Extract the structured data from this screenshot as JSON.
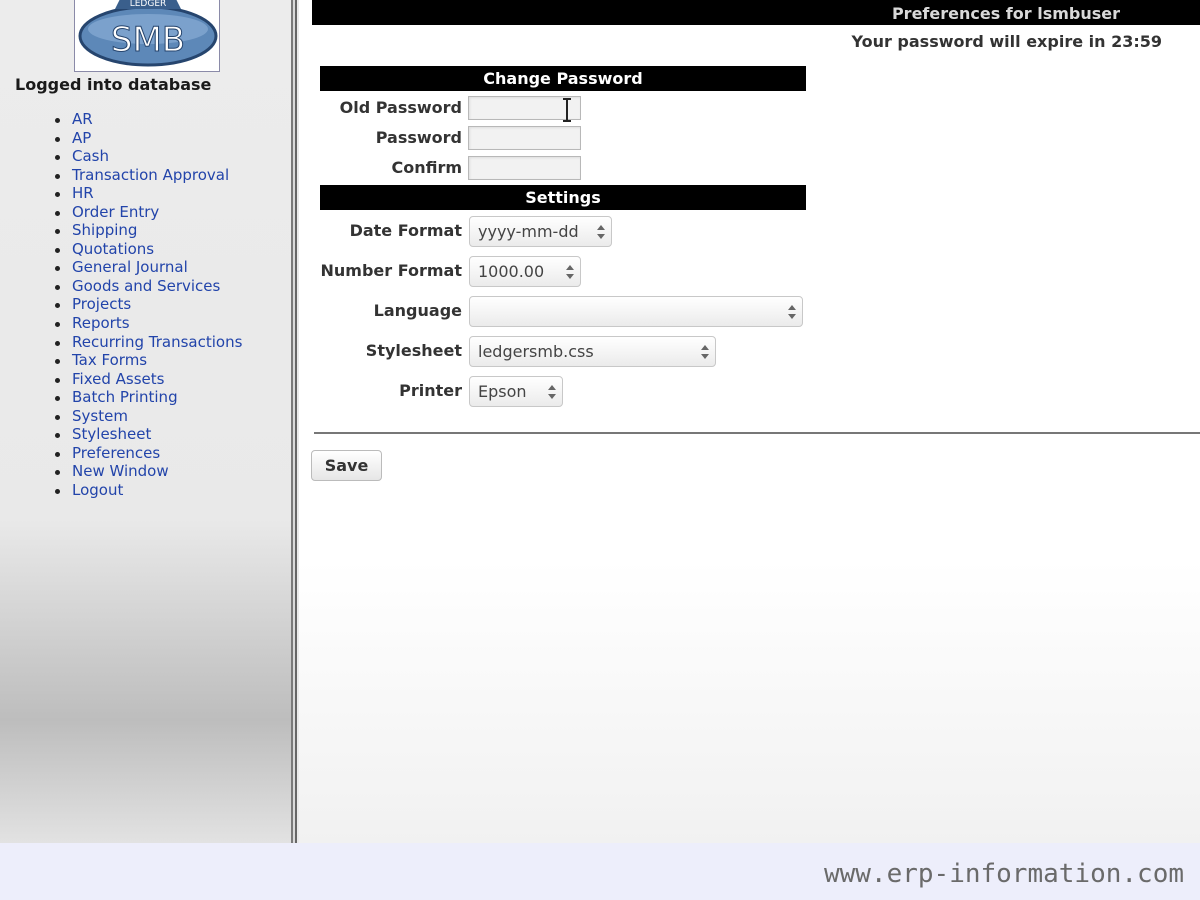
{
  "logo": {
    "top_text": "LEDGER",
    "main_text": "SMB"
  },
  "sidebar": {
    "login_text": "Logged into database",
    "menu": [
      {
        "label": "AR"
      },
      {
        "label": "AP"
      },
      {
        "label": "Cash"
      },
      {
        "label": "Transaction Approval"
      },
      {
        "label": "HR"
      },
      {
        "label": "Order Entry"
      },
      {
        "label": "Shipping"
      },
      {
        "label": "Quotations"
      },
      {
        "label": "General Journal"
      },
      {
        "label": "Goods and Services"
      },
      {
        "label": "Projects"
      },
      {
        "label": "Reports"
      },
      {
        "label": "Recurring Transactions"
      },
      {
        "label": "Tax Forms"
      },
      {
        "label": "Fixed Assets"
      },
      {
        "label": "Batch Printing"
      },
      {
        "label": "System"
      },
      {
        "label": "Stylesheet"
      },
      {
        "label": "Preferences"
      },
      {
        "label": "New Window"
      },
      {
        "label": "Logout"
      }
    ]
  },
  "header": {
    "title": "Preferences for lsmbuser",
    "expire_notice": "Your password will expire in 23:59"
  },
  "change_password": {
    "section_title": "Change Password",
    "old_password_label": "Old Password",
    "old_password_value": "",
    "password_label": "Password",
    "password_value": "",
    "confirm_label": "Confirm",
    "confirm_value": ""
  },
  "settings": {
    "section_title": "Settings",
    "date_format_label": "Date Format",
    "date_format_value": "yyyy-mm-dd",
    "number_format_label": "Number Format",
    "number_format_value": "1000.00",
    "language_label": "Language",
    "language_value": "",
    "stylesheet_label": "Stylesheet",
    "stylesheet_value": "ledgersmb.css",
    "printer_label": "Printer",
    "printer_value": "Epson"
  },
  "actions": {
    "save_label": "Save"
  },
  "watermark": "www.erp-information.com",
  "colors": {
    "link": "#2244aa",
    "header_bg": "#000000",
    "footer_bg": "#edeefb"
  }
}
